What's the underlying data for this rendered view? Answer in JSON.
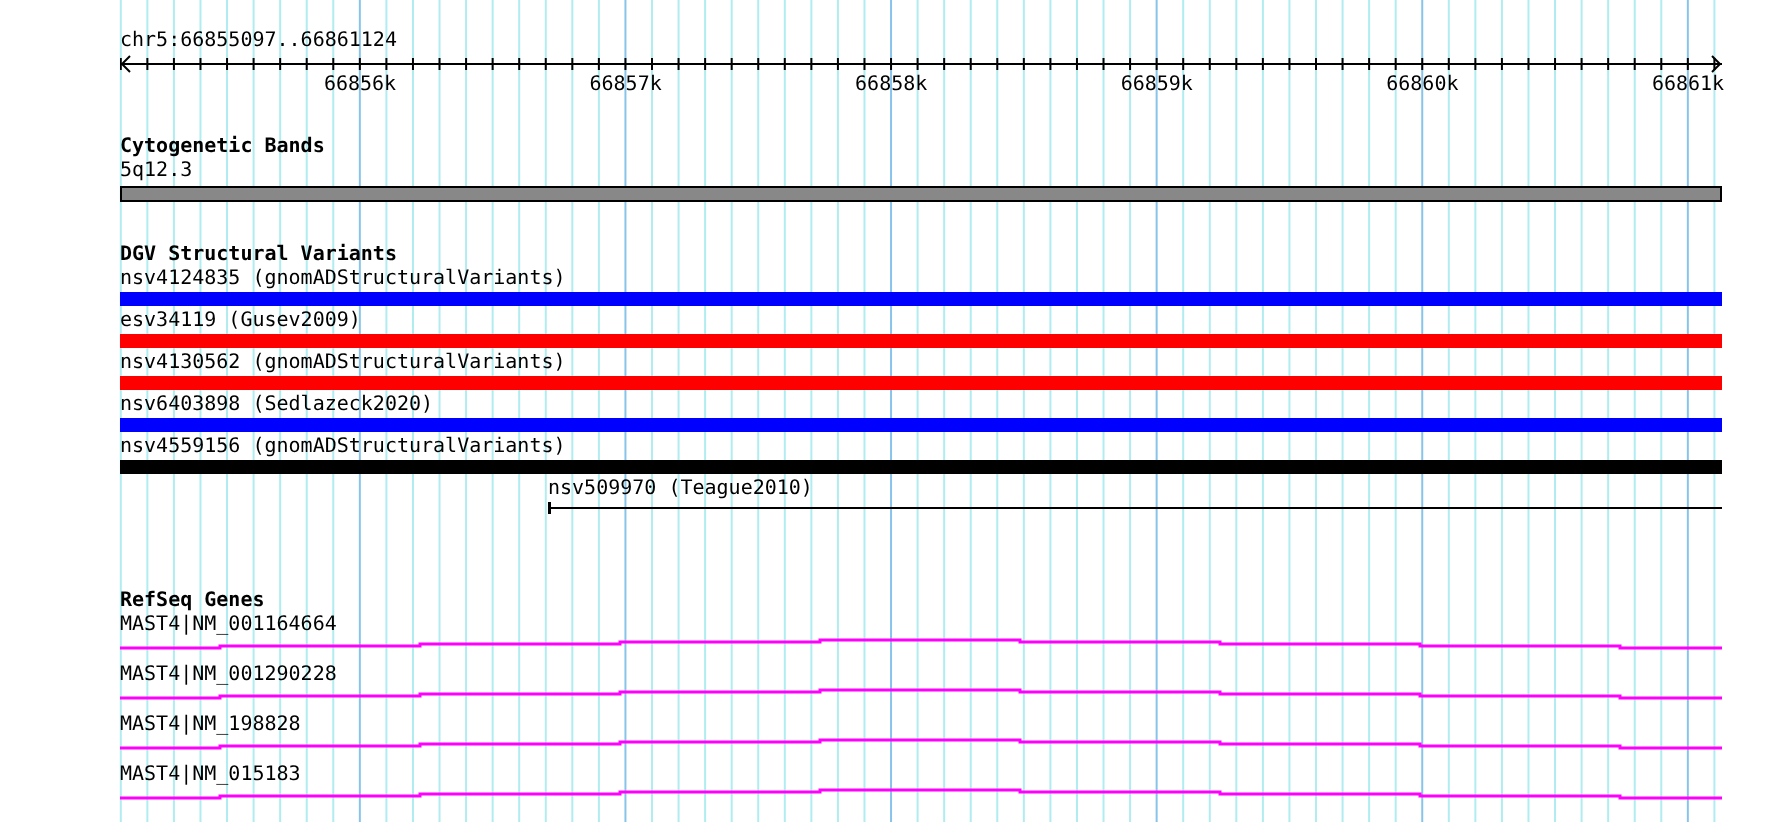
{
  "ruler": {
    "region": "chr5:66855097..66861124",
    "ticks": [
      "66856k",
      "66857k",
      "66858k",
      "66859k",
      "66860k",
      "66861k"
    ]
  },
  "tracks": [
    {
      "title": "Cytogenetic Bands",
      "features": [
        {
          "label": "5q12.3",
          "kind": "band"
        }
      ]
    },
    {
      "title": "DGV Structural Variants",
      "features": [
        {
          "label": "nsv4124835 (gnomADStructuralVariants)",
          "kind": "bar",
          "color": "#0000ff"
        },
        {
          "label": "esv34119 (Gusev2009)",
          "kind": "bar",
          "color": "#ff0000"
        },
        {
          "label": "nsv4130562 (gnomADStructuralVariants)",
          "kind": "bar",
          "color": "#ff0000"
        },
        {
          "label": "nsv6403898 (Sedlazeck2020)",
          "kind": "bar",
          "color": "#0000ff"
        },
        {
          "label": "nsv4559156 (gnomADStructuralVariants)",
          "kind": "bar",
          "color": "#000000"
        },
        {
          "label": "nsv509970 (Teague2010)",
          "kind": "line"
        }
      ]
    },
    {
      "title": "RefSeq Genes",
      "features": [
        {
          "label": "MAST4|NM_001164664",
          "kind": "gene"
        },
        {
          "label": "MAST4|NM_001290228",
          "kind": "gene"
        },
        {
          "label": "MAST4|NM_198828",
          "kind": "gene"
        },
        {
          "label": "MAST4|NM_015183",
          "kind": "gene"
        }
      ]
    }
  ]
}
